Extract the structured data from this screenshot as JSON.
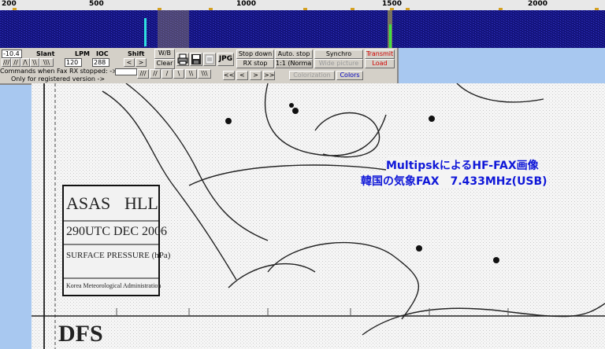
{
  "frequency_scale": {
    "labels": [
      "200",
      "500",
      "1000",
      "1500",
      "2000"
    ]
  },
  "toolbar": {
    "slant_value": "-10.4",
    "slant_label": "Slant",
    "lpm_label": "LPM",
    "lpm_value": "120",
    "ioc_label": "IOC",
    "ioc_value": "288",
    "shift_label": "Shift",
    "wb_label": "W/B",
    "clear_label": "Clear",
    "jpg_label": "JPG",
    "stop_down_label": "Stop down",
    "rx_stop_label": "RX stop",
    "auto_stop_label": "Auto. stop",
    "ratio_label": "1:1 (Normal)",
    "synchro_label": "Synchro",
    "wide_picture_label": "Wide picture",
    "transmit_label": "Transmit",
    "load_label": "Load",
    "colorization_label": "Colorization",
    "colors_label": "Colors",
    "commands_note": "Commands when Fax RX stopped: ->",
    "registered_note": "Only for registered version ->",
    "slant_buttons_row1": [
      "///",
      "//",
      "/\\",
      "\\\\",
      "\\\\\\"
    ],
    "slant_buttons_row2": [
      "///",
      "//",
      "/",
      "\\",
      "\\\\",
      "\\\\\\"
    ],
    "shift_buttons": [
      "<",
      ">"
    ],
    "nav_buttons": [
      "<<",
      "<",
      ">",
      ">>"
    ]
  },
  "fax": {
    "caption_line1": "MultipskによるHF-FAX画像",
    "caption_line2": "韓国の気象FAX　7.433MHz(USB)",
    "chart_title_1": "ASAS",
    "chart_title_2": "HLL",
    "chart_date": "290UTC DEC 2006",
    "chart_subtitle": "SURFACE PRESSURE (hPa)",
    "chart_issuer": "Korea Meteorological Administration",
    "chart_footer": "DFS"
  },
  "colors": {
    "waterfall": "#101070",
    "caption": "#1018d8",
    "window_bg": "#a8c8f0"
  }
}
